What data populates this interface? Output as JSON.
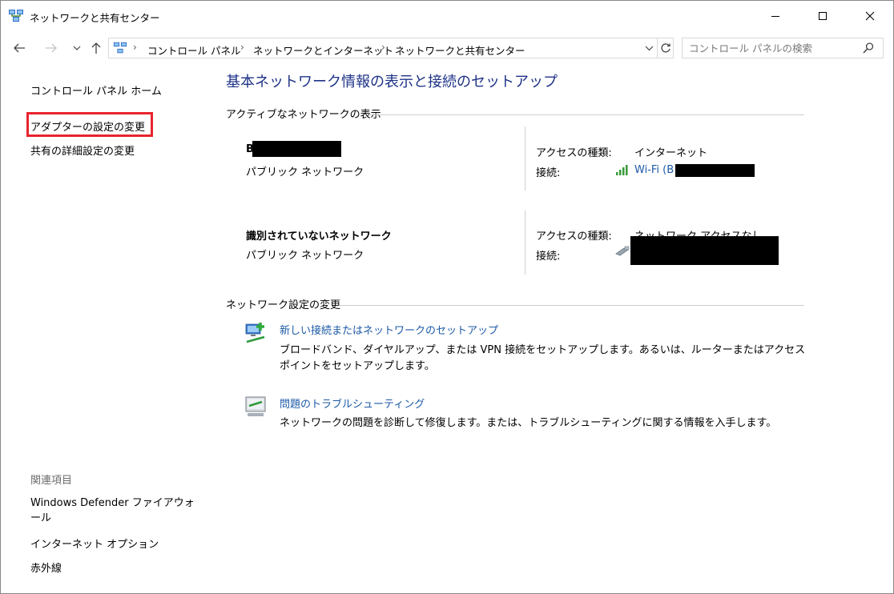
{
  "window": {
    "title": "ネットワークと共有センター"
  },
  "address": {
    "crumbs": [
      "コントロール パネル",
      "ネットワークとインターネット",
      "ネットワークと共有センター"
    ],
    "search_placeholder": "コントロール パネルの検索"
  },
  "sidebar": {
    "home": "コントロール パネル ホーム",
    "adapter": "アダプターの設定の変更",
    "sharing": "共有の詳細設定の変更",
    "related_title": "関連項目",
    "related": [
      "Windows Defender ファイアウォール",
      "インターネット オプション",
      "赤外線"
    ]
  },
  "main": {
    "title": "基本ネットワーク情報の表示と接続のセットアップ",
    "active_header": "アクティブなネットワークの表示",
    "networks": [
      {
        "name": "B",
        "type": "パブリック ネットワーク",
        "access_label": "アクセスの種類:",
        "access_value": "インターネット",
        "conn_label": "接続:",
        "conn_value": "Wi-Fi (B"
      },
      {
        "name": "識別されていないネットワーク",
        "type": "パブリック ネットワーク",
        "access_label": "アクセスの種類:",
        "access_value": "ネットワーク アクセスなし",
        "conn_label": "接続:",
        "conn_value": ""
      }
    ],
    "settings_header": "ネットワーク設定の変更",
    "tasks": [
      {
        "link": "新しい接続またはネットワークのセットアップ",
        "desc": "ブロードバンド、ダイヤルアップ、または VPN 接続をセットアップします。あるいは、ルーターまたはアクセス ポイントをセットアップします。"
      },
      {
        "link": "問題のトラブルシューティング",
        "desc": "ネットワークの問題を診断して修復します。または、トラブルシューティングに関する情報を入手します。"
      }
    ]
  },
  "colors": {
    "title_blue": "#1e3287",
    "link_blue": "#1c5aa6",
    "highlight_red": "#e8242d",
    "wifi_green": "#3a9a3a"
  }
}
